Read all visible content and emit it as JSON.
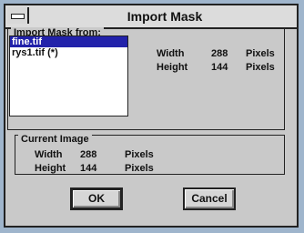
{
  "dialog": {
    "title": "Import Mask"
  },
  "import_from": {
    "label": "Import Mask from:",
    "files": [
      "fine.tif",
      "rys1.tif (*)"
    ],
    "selected_index": 0,
    "width_label": "Width",
    "width_value": "288",
    "height_label": "Height",
    "height_value": "144",
    "unit": "Pixels"
  },
  "current_image": {
    "label": "Current Image",
    "width_label": "Width",
    "width_value": "288",
    "height_label": "Height",
    "height_value": "144",
    "unit": "Pixels"
  },
  "buttons": {
    "ok_label": "OK",
    "cancel_label": "Cancel"
  },
  "colors": {
    "selection": "#2222aa",
    "dialog_bg": "#c9c9c9",
    "desktop": "#9fb5cc"
  }
}
